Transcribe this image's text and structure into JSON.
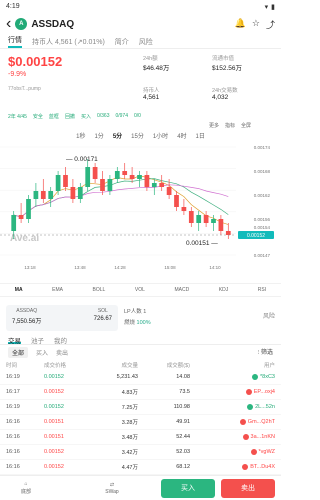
{
  "status": {
    "time": "4:19",
    "battery": "▮"
  },
  "header": {
    "title": "ASSDAQ",
    "logo_text": "A"
  },
  "tabs": [
    "行情",
    "持币人 4,561 (↗0.01%)",
    "简介",
    "风险"
  ],
  "price": {
    "value": "$0.00152",
    "change": "-9.9%",
    "address": "77obsT...pump"
  },
  "stats": [
    {
      "k": "24h额",
      "v": "$46.48万"
    },
    {
      "k": "流通市值",
      "v": "$152.56万"
    },
    {
      "k": "持币人",
      "v": "4,561"
    },
    {
      "k": "24h交易数",
      "v": "4,032"
    }
  ],
  "badges": [
    "2年 4/45",
    "安全",
    "蓝框",
    "回撤",
    "买入",
    "0/363",
    "0/974",
    "0/0"
  ],
  "intervals": [
    "1秒",
    "1分",
    "5分",
    "15分",
    "1小时",
    "4时",
    "1日"
  ],
  "active_interval": "5分",
  "tools": [
    "更多",
    "指标",
    "全屏"
  ],
  "chart_data": {
    "type": "candlestick",
    "annotations": [
      "0.00171",
      "0.00151",
      "0.00152"
    ],
    "y_ticks": [
      "0.00174",
      "0.00168",
      "0.00162",
      "0.00156",
      "0.00154",
      "0.00152",
      "0.00147"
    ],
    "x_ticks": [
      "13:18",
      "13:48",
      "14:28",
      "15:08",
      "14:10"
    ],
    "watermark": "Ave.ai",
    "candles": [
      [
        0.00153,
        0.00158,
        0.00151,
        0.00157
      ],
      [
        0.00157,
        0.0016,
        0.00155,
        0.00156
      ],
      [
        0.00156,
        0.00162,
        0.00155,
        0.00161
      ],
      [
        0.00161,
        0.00165,
        0.00159,
        0.00163
      ],
      [
        0.00163,
        0.00166,
        0.0016,
        0.00161
      ],
      [
        0.00161,
        0.00164,
        0.00159,
        0.00163
      ],
      [
        0.00163,
        0.00168,
        0.00162,
        0.00167
      ],
      [
        0.00167,
        0.00169,
        0.00163,
        0.00164
      ],
      [
        0.00164,
        0.00166,
        0.0016,
        0.00161
      ],
      [
        0.00161,
        0.00165,
        0.0016,
        0.00164
      ],
      [
        0.00164,
        0.00171,
        0.00163,
        0.00169
      ],
      [
        0.00169,
        0.0017,
        0.00165,
        0.00166
      ],
      [
        0.00166,
        0.00168,
        0.00162,
        0.00163
      ],
      [
        0.00163,
        0.00167,
        0.00162,
        0.00166
      ],
      [
        0.00166,
        0.00169,
        0.00165,
        0.00168
      ],
      [
        0.00168,
        0.0017,
        0.00166,
        0.00167
      ],
      [
        0.00167,
        0.00169,
        0.00165,
        0.00166
      ],
      [
        0.00166,
        0.00168,
        0.00164,
        0.00167
      ],
      [
        0.00167,
        0.00168,
        0.00163,
        0.00164
      ],
      [
        0.00164,
        0.00166,
        0.00162,
        0.00165
      ],
      [
        0.00165,
        0.00167,
        0.00163,
        0.00164
      ],
      [
        0.00164,
        0.00166,
        0.00161,
        0.00162
      ],
      [
        0.00162,
        0.00163,
        0.00158,
        0.00159
      ],
      [
        0.00159,
        0.00161,
        0.00157,
        0.00158
      ],
      [
        0.00158,
        0.00159,
        0.00154,
        0.00155
      ],
      [
        0.00155,
        0.00158,
        0.00153,
        0.00157
      ],
      [
        0.00157,
        0.00158,
        0.00154,
        0.00155
      ],
      [
        0.00155,
        0.00157,
        0.00153,
        0.00156
      ],
      [
        0.00156,
        0.00157,
        0.00152,
        0.00153
      ],
      [
        0.00153,
        0.00155,
        0.00151,
        0.00152
      ]
    ]
  },
  "indicators": [
    "MA",
    "EMA",
    "BOLL",
    "VOL",
    "MACD",
    "KDJ",
    "RSI"
  ],
  "pool": {
    "a_label": "ASSDAQ",
    "a_val": "7,550.56万",
    "b_label": "SOL",
    "b_val": "726.67",
    "lp_label": "LP人数",
    "lp_val": "1",
    "burn_label": "燃烧",
    "burn_val": "100%",
    "risk": "风险"
  },
  "trade_tabs": [
    "交易",
    "池子",
    "我的"
  ],
  "sub_tabs": [
    "全部",
    "买入",
    "卖出"
  ],
  "filter_label": "筛选",
  "columns": [
    "时间",
    "成交价格",
    "成交量",
    "成交额($)",
    "用户"
  ],
  "rows": [
    {
      "t": "16:19",
      "p": "0.00152",
      "side": "buy",
      "q": "5,231.43",
      "v": "14.08",
      "m": "*8xC3"
    },
    {
      "t": "16:17",
      "p": "0.00152",
      "side": "sell",
      "q": "4.83万",
      "v": "73.5",
      "m": "EP...oxj4"
    },
    {
      "t": "16:19",
      "p": "0.00152",
      "side": "buy",
      "q": "7.25万",
      "v": "110.98",
      "m": "2L...52n"
    },
    {
      "t": "16:16",
      "p": "0.00151",
      "side": "sell",
      "q": "3.28万",
      "v": "49.91",
      "m": "Gm...Q2hT"
    },
    {
      "t": "16:16",
      "p": "0.00151",
      "side": "sell",
      "q": "3.48万",
      "v": "52.44",
      "m": "3a...1nKN"
    },
    {
      "t": "16:16",
      "p": "0.00152",
      "side": "sell",
      "q": "3.42万",
      "v": "52.03",
      "m": "*vgWZ"
    },
    {
      "t": "16:16",
      "p": "0.00152",
      "side": "sell",
      "q": "4.47万",
      "v": "68.12",
      "m": "BT...Du4X"
    },
    {
      "t": "16:16",
      "p": "0.00152",
      "side": "sell",
      "q": "9,678.75",
      "v": "14.74",
      "m": "*z2Gz"
    },
    {
      "t": "16:16",
      "p": "0.00152",
      "side": "sell",
      "q": "3.22万",
      "v": "49.11",
      "m": "YkuvA"
    }
  ],
  "bottom": {
    "nav1": "底部",
    "nav2": "SWap",
    "buy": "买入",
    "sell": "卖出"
  },
  "colors": {
    "up": "#2bb680",
    "down": "#f4504d",
    "accent": "#1bb"
  }
}
